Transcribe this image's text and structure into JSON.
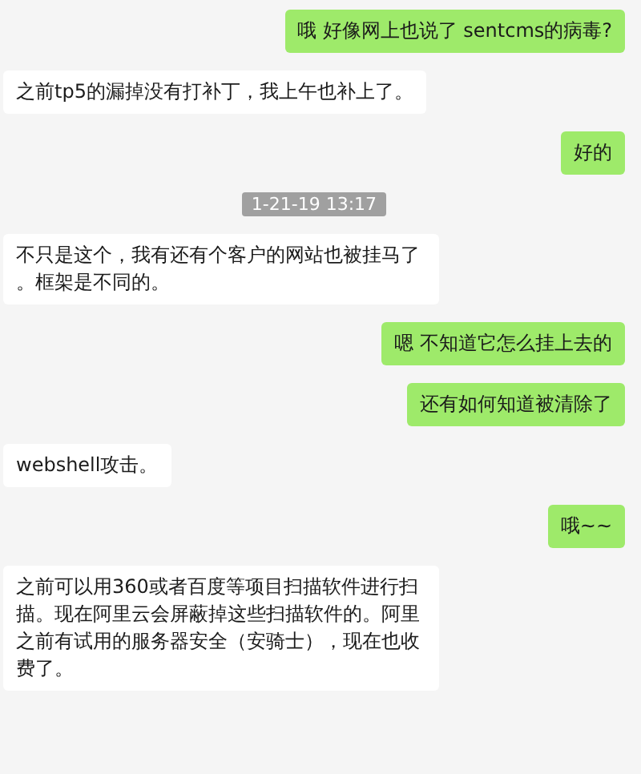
{
  "messages": [
    {
      "kind": "sent",
      "text": "哦 好像网上也说了 sentcms的病毒?"
    },
    {
      "kind": "received",
      "text": "之前tp5的漏掉没有打补丁，我上午也补上了。"
    },
    {
      "kind": "sent",
      "text": "好的"
    },
    {
      "kind": "time",
      "text": "1-21-19 13:17"
    },
    {
      "kind": "received",
      "text": "不只是这个，我有还有个客户的网站也被挂马了。框架是不同的。"
    },
    {
      "kind": "sent",
      "text": "嗯 不知道它怎么挂上去的"
    },
    {
      "kind": "sent",
      "text": "还有如何知道被清除了"
    },
    {
      "kind": "received",
      "text": "webshell攻击。"
    },
    {
      "kind": "sent",
      "text": "哦~~"
    },
    {
      "kind": "received",
      "text": "之前可以用360或者百度等项目扫描软件进行扫描。现在阿里云会屏蔽掉这些扫描软件的。阿里之前有试用的服务器安全（安骑士），现在也收费了。"
    }
  ]
}
